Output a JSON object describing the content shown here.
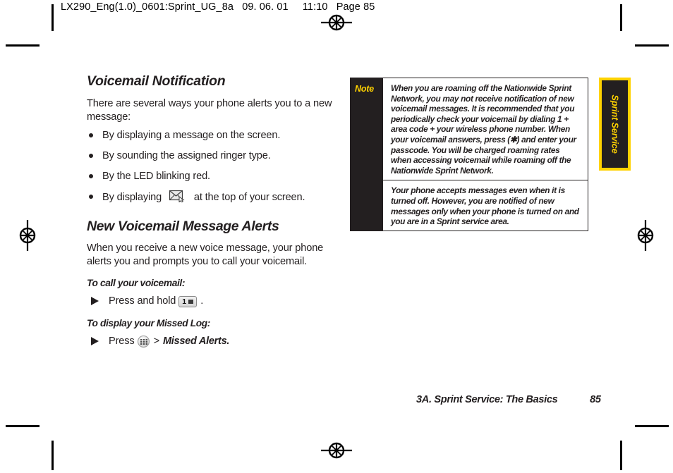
{
  "print_slug": {
    "job": "LX290_Eng(1.0)_0601:Sprint_UG_8a",
    "date": "09. 06. 01",
    "time": "11:10",
    "page_label": "Page 85"
  },
  "content": {
    "section1": {
      "heading": "Voicemail Notification",
      "intro": "There are several ways your phone alerts you to a new message:",
      "bullets": [
        {
          "pre": "By displaying a message on the screen.",
          "icon": null,
          "post": ""
        },
        {
          "pre": "By sounding the assigned ringer type.",
          "icon": null,
          "post": ""
        },
        {
          "pre": "By the LED blinking red.",
          "icon": null,
          "post": ""
        },
        {
          "pre": "By displaying",
          "icon": "envelope-icon",
          "post": "at the top of your screen."
        }
      ]
    },
    "section2": {
      "heading": "New Voicemail Message Alerts",
      "intro": "When you receive a new voice message, your phone alerts you and prompts you to call your voicemail.",
      "steps": [
        {
          "lead": "To call your voicemail:",
          "text_before": "Press and hold",
          "key_icon": "key-1-voicemail-icon",
          "key_label": "1",
          "text_after": ".",
          "emphasis": ""
        },
        {
          "lead": "To display your Missed Log:",
          "text_before": "Press",
          "key_icon": "menu-key-icon",
          "key_label": "",
          "text_after": ">",
          "emphasis": "Missed Alerts."
        }
      ]
    }
  },
  "note_box": {
    "label": "Note",
    "paragraphs": [
      "When you are roaming off the Nationwide Sprint Network, you may not receive notification of new voicemail messages. It is recommended that you periodically check your voicemail by dialing 1 + area code + your wireless phone number. When your voicemail answers, press (✱) and enter your passcode. You will be charged roaming rates when accessing voicemail while roaming off the Nationwide Sprint Network.",
      "Your phone accepts messages even when it is turned off. However, you are notified of new messages only when your phone is turned on and you are in a Sprint service area."
    ]
  },
  "side_tab": {
    "label": "Sprint Service"
  },
  "footer": {
    "chapter": "3A. Sprint Service: The Basics",
    "page_number": "85"
  },
  "colors": {
    "accent_yellow": "#ffd200",
    "ink_black": "#231f20",
    "page_white": "#ffffff"
  }
}
